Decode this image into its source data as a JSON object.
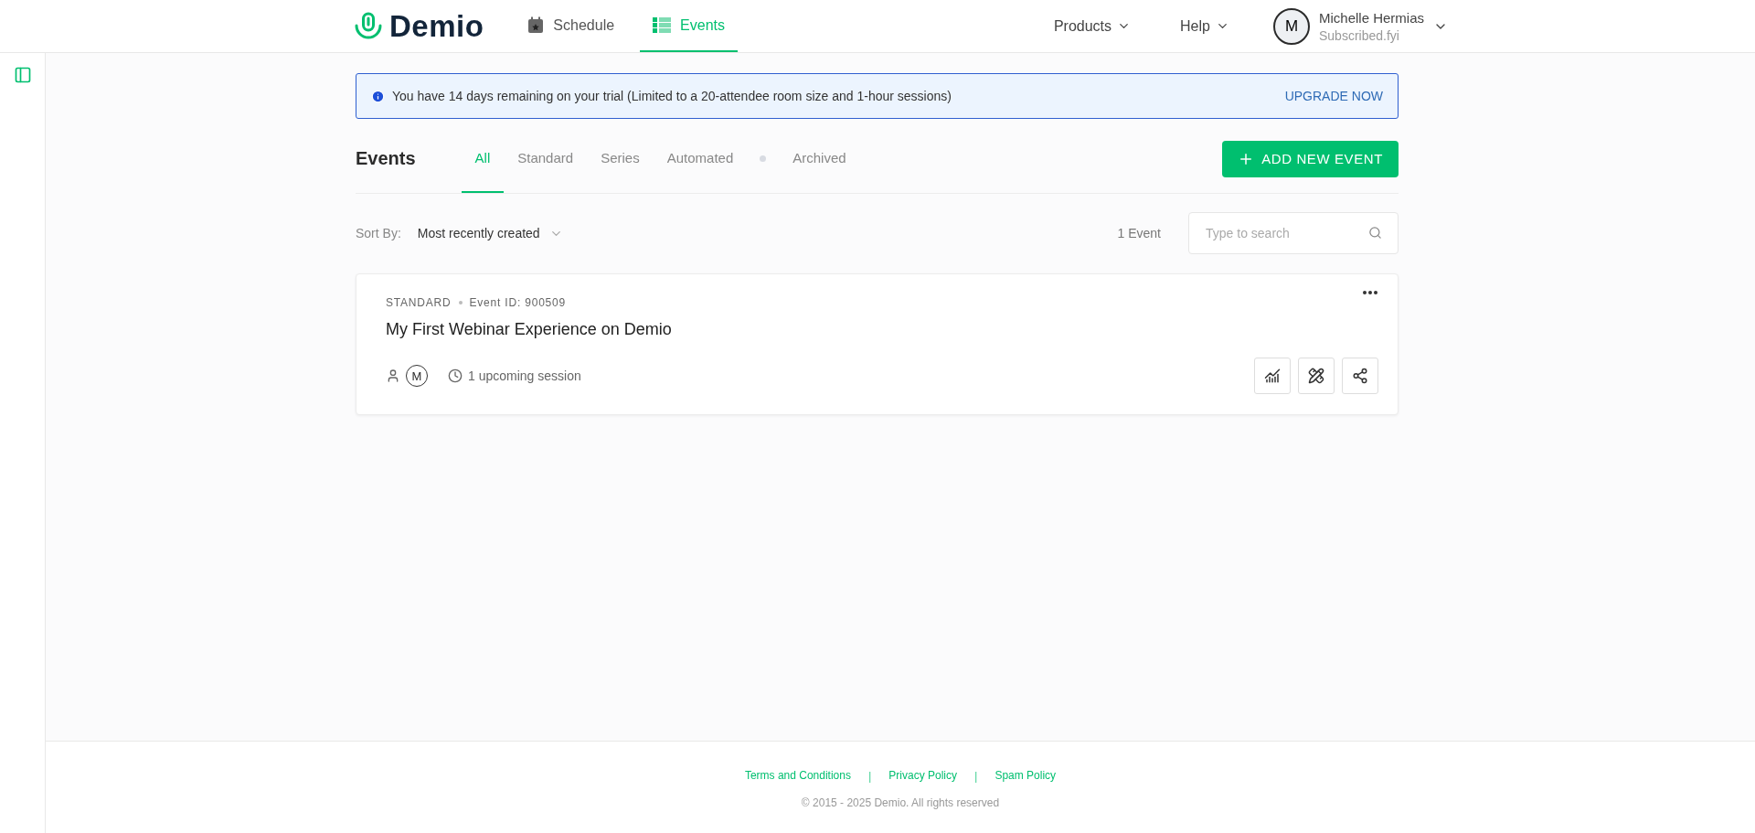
{
  "header": {
    "logo": "Demio",
    "nav": [
      {
        "label": "Schedule",
        "kind": "calendar",
        "selected": false
      },
      {
        "label": "Events",
        "kind": "list",
        "selected": true
      }
    ],
    "menus": [
      "Products",
      "Help"
    ],
    "user": {
      "initial": "M",
      "name": "Michelle Hermias",
      "org": "Subscribed.fyi"
    }
  },
  "banner": {
    "message": "You have 14 days remaining on your trial (Limited to a 20-attendee room size and 1-hour sessions)",
    "action": "UPGRADE NOW"
  },
  "events": {
    "title": "Events",
    "tabs": [
      {
        "label": "All",
        "selected": true
      },
      {
        "label": "Standard",
        "selected": false
      },
      {
        "label": "Series",
        "selected": false
      },
      {
        "label": "Automated",
        "selected": false
      },
      {
        "label": "Archived",
        "selected": false
      }
    ],
    "add_button": "ADD NEW EVENT",
    "sort_label": "Sort By:",
    "sort_value": "Most recently created",
    "count": "1 Event",
    "search": {
      "placeholder": "Type to search"
    },
    "cards": [
      {
        "type": "STANDARD",
        "event_id": "Event ID: 900509",
        "title": "My First Webinar Experience on Demio",
        "host_initial": "M",
        "sessions": "1 upcoming session"
      }
    ]
  },
  "footer": {
    "items": [
      {
        "kind": "link",
        "text": "Terms and Conditions"
      },
      {
        "kind": "separator",
        "text": "|"
      },
      {
        "kind": "link",
        "text": "Privacy Policy"
      },
      {
        "kind": "separator",
        "text": "|"
      },
      {
        "kind": "link",
        "text": "Spam Policy"
      }
    ],
    "copyright": "© 2015 - 2025 Demio. All rights reserved"
  }
}
